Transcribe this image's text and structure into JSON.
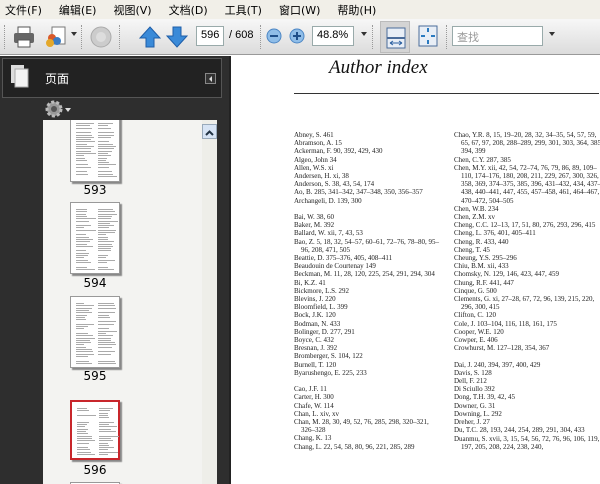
{
  "menu": [
    "文件(F)",
    "编辑(E)",
    "视图(V)",
    "文档(D)",
    "工具(T)",
    "窗口(W)",
    "帮助(H)"
  ],
  "toolbar": {
    "page_current": "596",
    "page_total": "/ 608",
    "zoom": "48.8%",
    "search_placeholder": "查找"
  },
  "icons": [
    "printer-icon",
    "share-icon",
    "globe-icon",
    "prev-page-icon",
    "next-page-icon",
    "zoom-out-icon",
    "zoom-in-icon",
    "fit-width-icon",
    "fit-page-icon",
    "pages-icon",
    "gear-icon"
  ],
  "sidebar": {
    "title": "页面",
    "thumbnails": [
      "593",
      "594",
      "595",
      "596"
    ],
    "selected": "596"
  },
  "colors": {
    "selected_border": "#c8262b",
    "panel_bg": "#2e2e2e"
  },
  "document": {
    "title": "Author index",
    "left_column": [
      "Abney, S. 461",
      "Abramson, A. 15",
      "Ackerman, F. 90, 392, 429, 430",
      "Algeo, John 34",
      "Allen, W.S. xi",
      "Andersen, H. xi, 38",
      "Anderson, S. 38, 43, 54, 174",
      "Ao, B. 285, 341–342, 347–348, 350, 356–357",
      "Archangeli, D. 139, 300",
      "",
      "Bai, W. 38, 60",
      "Baker, M. 392",
      "Ballard, W. xii, 7, 43, 53",
      "Bao, Z. 5, 18, 32, 54–57, 60–61, 72–76, 78–80, 95–96, 208, 471, 505",
      "Beattie, D. 375–376, 405, 408–411",
      "Beaudouin de Courtenay 149",
      "Beckman, M. 11, 28, 120, 225, 254, 291, 294, 304",
      "Bi, K.Z. 41",
      "Bickmore, L.S. 292",
      "Blevins, J. 220",
      "Bloomfield, L. 399",
      "Bock, J.K. 120",
      "Bodman, N. 433",
      "Bolinger, D. 277, 291",
      "Boyce, C. 432",
      "Bresnan, J. 392",
      "Bromberger, S. 104, 122",
      "Burnell, T. 120",
      "Byarushengo, E. 225, 233",
      "",
      "Cao, J.F. 11",
      "Carter, H. 300",
      "Chafe, W. 114",
      "Chan, L. xiv, xv",
      "Chan, M. 28, 30, 49, 52, 76, 285, 298, 320–321, 326–328",
      "Chang, K. 13",
      "Chang, L. 22, 54, 58, 80, 96, 221, 285, 289"
    ],
    "right_column": [
      "Chao, Y.R. 8, 15, 19–20, 28, 32, 34–35, 54, 57, 59, 65, 67, 97, 208, 288–289, 299, 301, 303, 364, 385, 394, 399",
      "Chen, C.Y. 287, 385",
      "Chen, M.Y. xii, 42, 54, 72–74, 76, 79, 86, 89, 109–110, 174–176, 180, 208, 211, 229, 267, 300, 326, 358, 369, 374–375, 385, 396, 431–432, 434, 437–438, 440–441, 447, 455, 457–458, 461, 464–467, 470–472, 504–505",
      "Chen, W.B. 234",
      "Chen, Z.M. xv",
      "Cheng, C.C. 12–13, 17, 51, 80, 276, 293, 296, 415",
      "Cheng, L. 376, 401, 405–411",
      "Cheng, R. 433, 440",
      "Cheng, T. 45",
      "Cheung, Y.S. 295–296",
      "Chiu, B.M. xii, 433",
      "Chomsky, N. 129, 146, 423, 447, 459",
      "Chung, R.F. 441, 447",
      "Cinque, G. 500",
      "Clements, G. xi, 27–28, 67, 72, 96, 139, 215, 220, 296, 300, 415",
      "Clifton, C. 120",
      "Cole, J. 103–104, 116, 118, 161, 175",
      "Cooper, W.E. 120",
      "Cowper, E. 406",
      "Crowhurst, M. 127–128, 354, 367",
      "",
      "Dai, J. 240, 394, 397, 400, 429",
      "Davis, S. 128",
      "Dell, F. 212",
      "Di Sciullo 392",
      "Dong, T.H. 39, 42, 45",
      "Downer, G. 31",
      "Downing, L. 292",
      "Dreher, J. 27",
      "Du, T.C. 28, 193, 244, 254, 289, 291, 304, 433",
      "Duanmu, S. xvii, 3, 15, 54, 56, 72, 76, 96, 106, 119, 197, 205, 208, 224, 238, 240,"
    ]
  }
}
